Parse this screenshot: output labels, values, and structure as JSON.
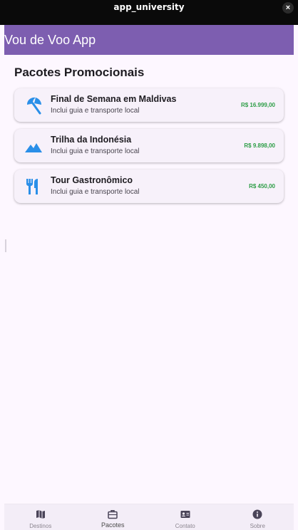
{
  "window": {
    "title": "app_university",
    "close_glyph": "×"
  },
  "appbar": {
    "title": "Vou de Voo App"
  },
  "section": {
    "title": "Pacotes Promocionais"
  },
  "packages": [
    {
      "name": "Final de Semana em Maldivas",
      "subtitle": "Inclui guia e transporte local",
      "price": "R$ 16.999,00",
      "icon": "beach-umbrella-icon"
    },
    {
      "name": "Trilha da Indonésia",
      "subtitle": "Inclui guia e transporte local",
      "price": "R$ 9.898,00",
      "icon": "landscape-mountain-icon"
    },
    {
      "name": "Tour Gastronômico",
      "subtitle": "Inclui guia e transporte local",
      "price": "R$ 450,00",
      "icon": "restaurant-icon"
    }
  ],
  "colors": {
    "accent": "#7d5eb0",
    "icon_blue": "#2a8fe8",
    "price_green": "#2e9e47"
  },
  "navbar": {
    "active": "Pacotes",
    "items": [
      {
        "label": "Destinos",
        "icon": "map-icon"
      },
      {
        "label": "Pacotes",
        "icon": "briefcase-icon"
      },
      {
        "label": "Contato",
        "icon": "contact-card-icon"
      },
      {
        "label": "Sobre",
        "icon": "info-icon"
      }
    ]
  }
}
